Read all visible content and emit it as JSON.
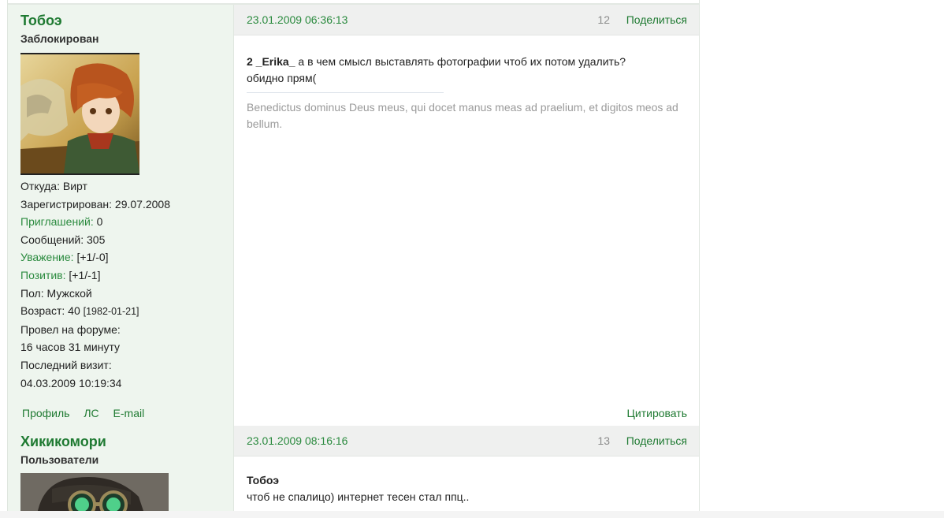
{
  "posts": [
    {
      "username": "Тобоэ",
      "user_title": "Заблокирован",
      "info": {
        "from_label": "Откуда:",
        "from_value": "Вирт",
        "registered_label": "Зарегистрирован:",
        "registered_value": "29.07.2008",
        "invites_label": "Приглашений:",
        "invites_value": "0",
        "messages_label": "Сообщений:",
        "messages_value": "305",
        "respect_label": "Уважение:",
        "respect_value": "[+1/-0]",
        "positive_label": "Позитив:",
        "positive_value": "[+1/-1]",
        "gender_label": "Пол:",
        "gender_value": "Мужской",
        "age_label": "Возраст:",
        "age_value": "40",
        "age_date": "[1982-01-21]",
        "online_label": "Провел на форуме:",
        "online_value": "16 часов 31 минуту",
        "last_visit_label": "Последний визит:",
        "last_visit_value": "04.03.2009 10:19:34"
      },
      "links": {
        "profile": "Профиль",
        "pm": "ЛС",
        "email": "E-mail"
      },
      "date": "23.01.2009 06:36:13",
      "number": "12",
      "share": "Поделиться",
      "message_bold": "2 _Erika_",
      "message_text": " а в чем смысл выставлять фотографии чтоб их потом удалить?",
      "message_line2": "обидно прям(",
      "signature": "Benedictus dominus Deus meus, qui docet manus meas ad praelium, et digitos meos ad bellum.",
      "quote": "Цитировать"
    },
    {
      "username": "Хикикомори",
      "user_title": "Пользователи",
      "date": "23.01.2009 08:16:16",
      "number": "13",
      "share": "Поделиться",
      "message_bold": "Тобоэ",
      "message_line2": "чтоб не спалицо) интернет тесен стал ппц.."
    }
  ]
}
